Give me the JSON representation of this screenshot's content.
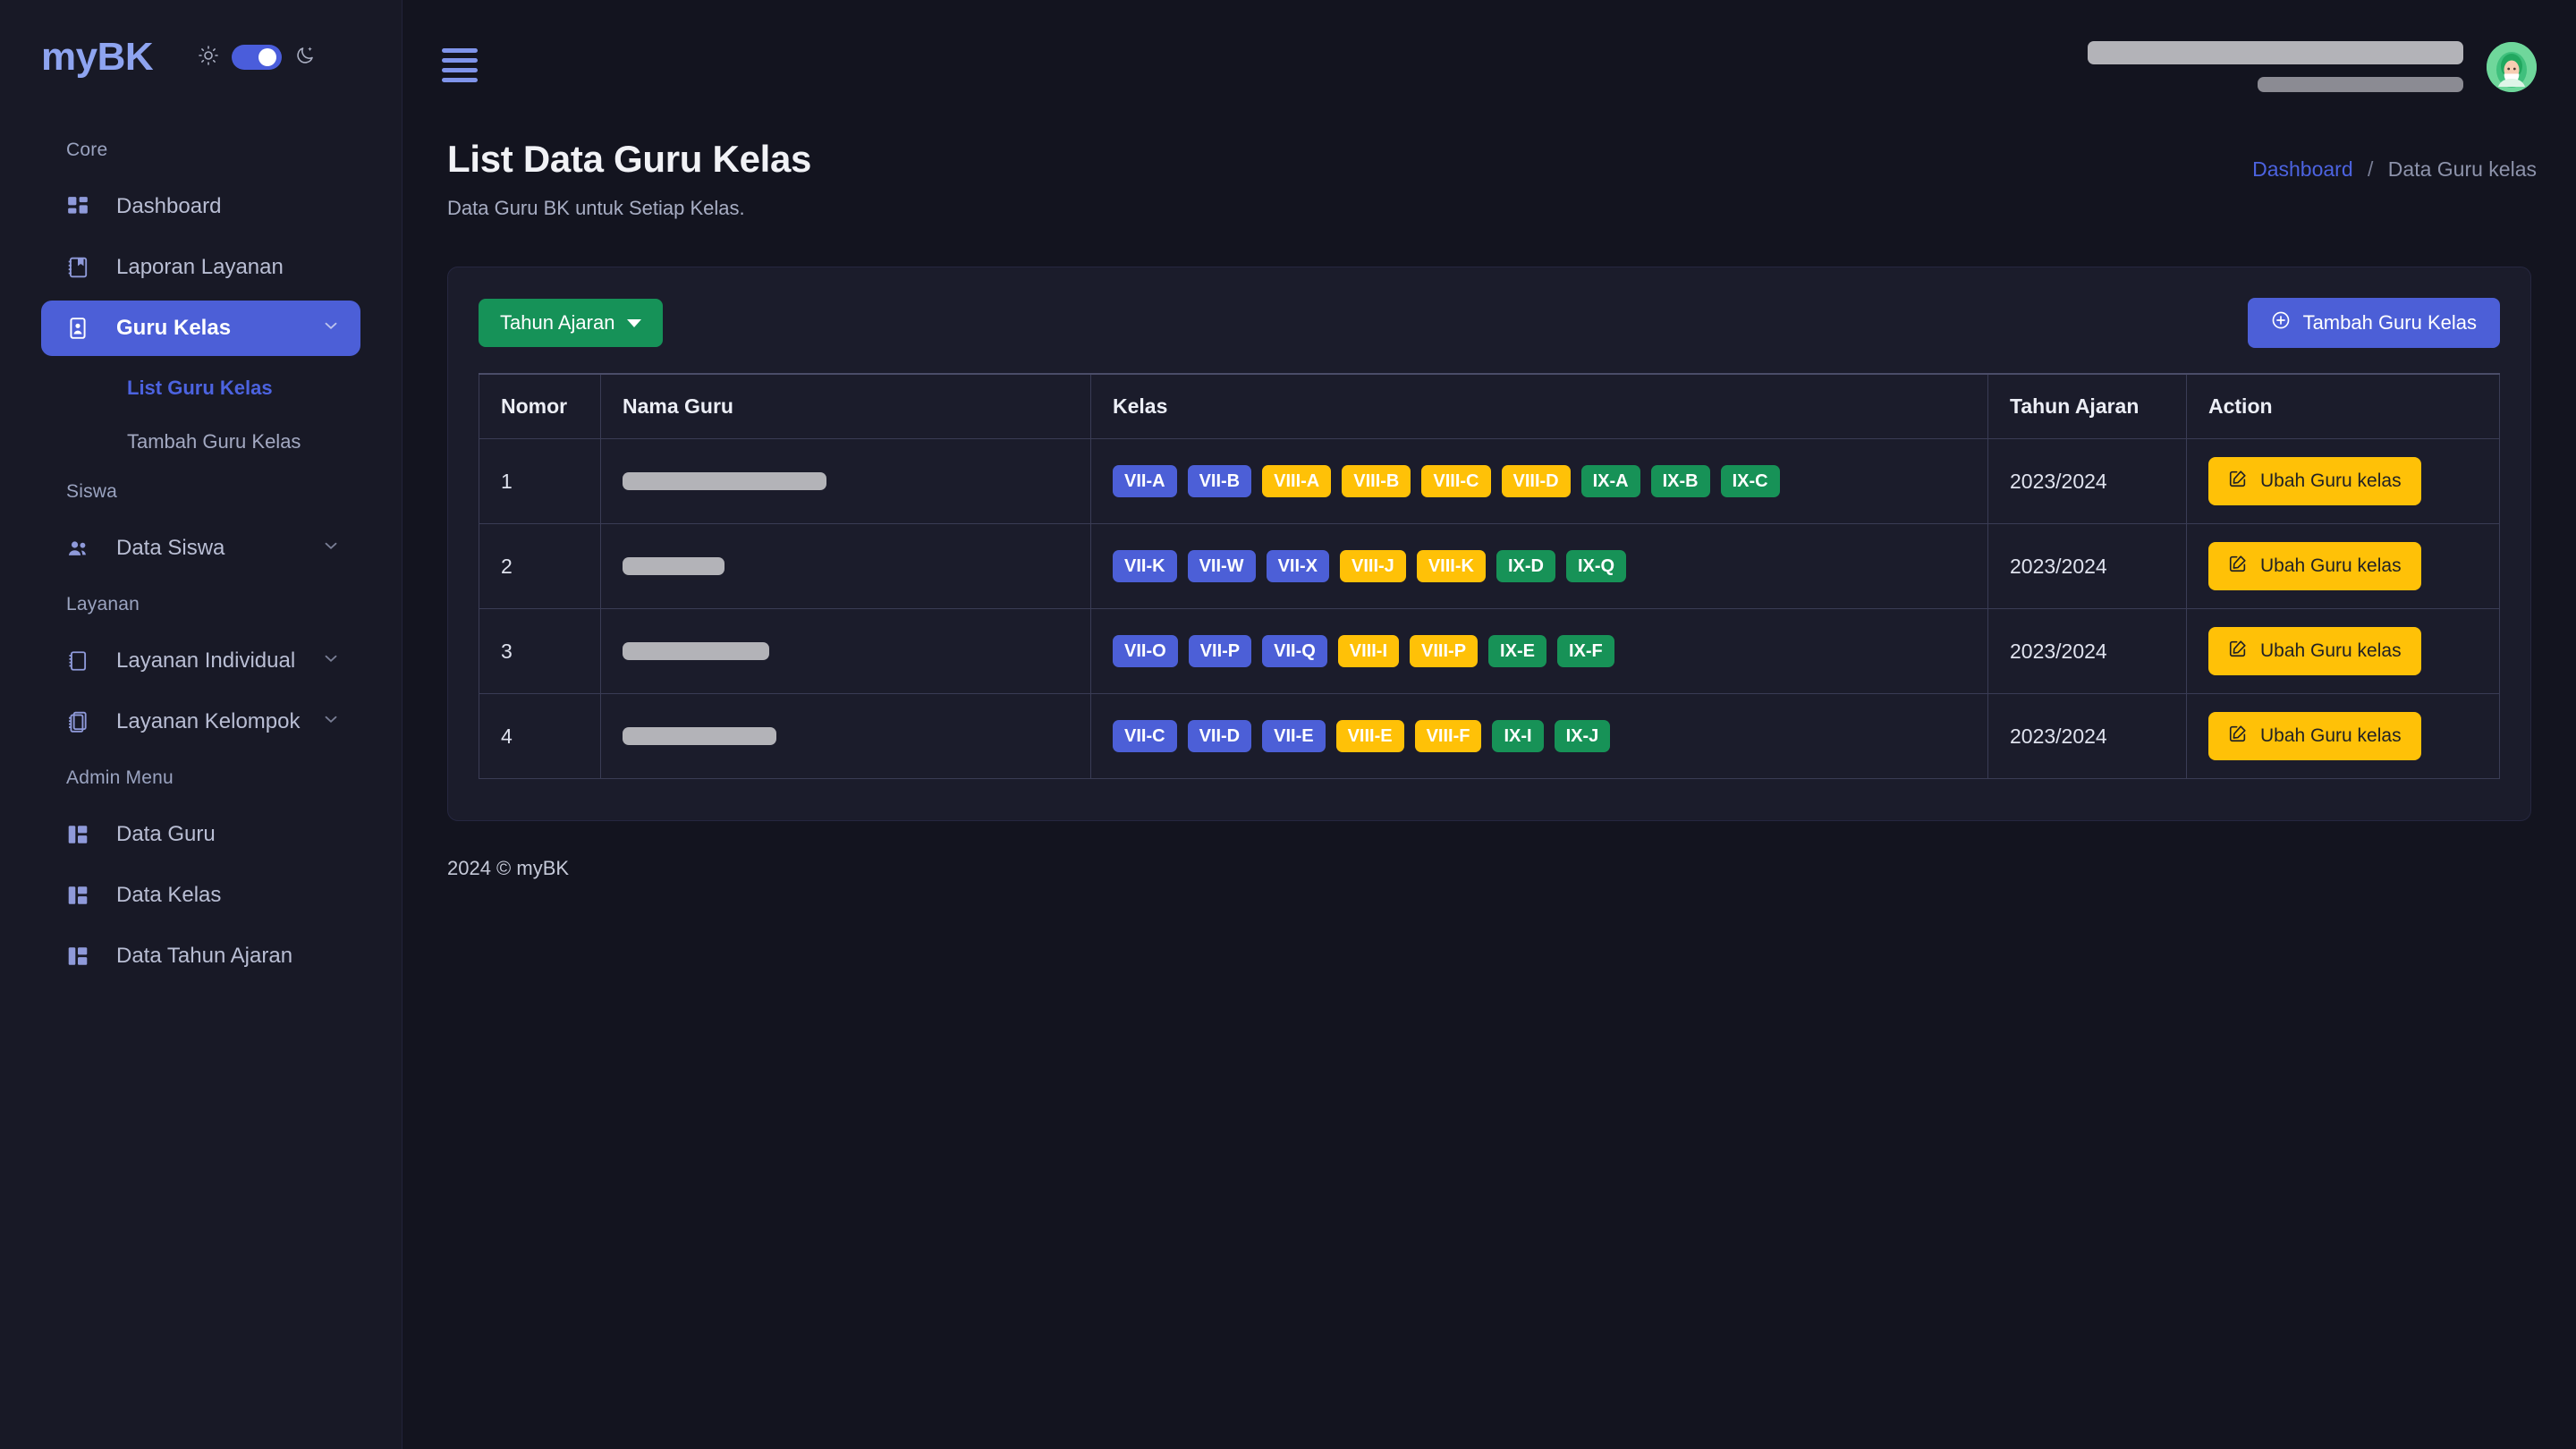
{
  "brand": {
    "name": "myBK",
    "sun_icon": "sun-icon",
    "moon_icon": "moon-icon",
    "toggle_state": "on"
  },
  "sidebar": {
    "sections": [
      {
        "label": "Core",
        "items": [
          {
            "label": "Dashboard",
            "icon": "grid-icon",
            "active": false,
            "expandable": false
          },
          {
            "label": "Laporan Layanan",
            "icon": "report-book-icon",
            "active": false,
            "expandable": false
          },
          {
            "label": "Guru Kelas",
            "icon": "id-card-icon",
            "active": true,
            "expandable": true
          }
        ],
        "subitems": [
          {
            "label": "List Guru Kelas",
            "active": true
          },
          {
            "label": "Tambah Guru Kelas",
            "active": false
          }
        ]
      },
      {
        "label": "Siswa",
        "items": [
          {
            "label": "Data Siswa",
            "icon": "people-icon",
            "active": false,
            "expandable": true
          }
        ],
        "subitems": []
      },
      {
        "label": "Layanan",
        "items": [
          {
            "label": "Layanan Individual",
            "icon": "notebook-icon",
            "active": false,
            "expandable": true
          },
          {
            "label": "Layanan Kelompok",
            "icon": "notebooks-icon",
            "active": false,
            "expandable": true
          }
        ],
        "subitems": []
      },
      {
        "label": "Admin Menu",
        "items": [
          {
            "label": "Data Guru",
            "icon": "columns-icon",
            "active": false,
            "expandable": false
          },
          {
            "label": "Data Kelas",
            "icon": "columns-icon",
            "active": false,
            "expandable": false
          },
          {
            "label": "Data Tahun Ajaran",
            "icon": "columns-icon",
            "active": false,
            "expandable": false
          }
        ],
        "subitems": []
      }
    ]
  },
  "topbar": {
    "menu_icon": "hamburger-icon",
    "user_name_redacted": true,
    "user_role_redacted": true,
    "avatar_icon": "user-avatar-hijab-icon"
  },
  "page": {
    "title": "List Data Guru Kelas",
    "subtitle": "Data Guru BK untuk Setiap Kelas.",
    "breadcrumb": {
      "root": "Dashboard",
      "separator": "/",
      "current": "Data Guru kelas"
    }
  },
  "toolbar": {
    "year_filter_label": "Tahun Ajaran",
    "year_filter_icon": "caret-down-icon",
    "add_label": "Tambah Guru Kelas",
    "add_icon": "plus-circle-icon"
  },
  "table": {
    "columns": [
      "Nomor",
      "Nama Guru",
      "Kelas",
      "Tahun Ajaran",
      "Action"
    ],
    "rows": [
      {
        "nomor": "1",
        "nama_guru_redacted": true,
        "nama_width": 228,
        "kelas": [
          {
            "label": "VII-A",
            "color": "blue"
          },
          {
            "label": "VII-B",
            "color": "blue"
          },
          {
            "label": "VIII-A",
            "color": "yellow"
          },
          {
            "label": "VIII-B",
            "color": "yellow"
          },
          {
            "label": "VIII-C",
            "color": "yellow"
          },
          {
            "label": "VIII-D",
            "color": "yellow"
          },
          {
            "label": "IX-A",
            "color": "green"
          },
          {
            "label": "IX-B",
            "color": "green"
          },
          {
            "label": "IX-C",
            "color": "green"
          }
        ],
        "tahun_ajaran": "2023/2024",
        "action_label": "Ubah Guru kelas",
        "action_icon": "edit-square-icon"
      },
      {
        "nomor": "2",
        "nama_guru_redacted": true,
        "nama_width": 114,
        "kelas": [
          {
            "label": "VII-K",
            "color": "blue"
          },
          {
            "label": "VII-W",
            "color": "blue"
          },
          {
            "label": "VII-X",
            "color": "blue"
          },
          {
            "label": "VIII-J",
            "color": "yellow"
          },
          {
            "label": "VIII-K",
            "color": "yellow"
          },
          {
            "label": "IX-D",
            "color": "green"
          },
          {
            "label": "IX-Q",
            "color": "green"
          }
        ],
        "tahun_ajaran": "2023/2024",
        "action_label": "Ubah Guru kelas",
        "action_icon": "edit-square-icon"
      },
      {
        "nomor": "3",
        "nama_guru_redacted": true,
        "nama_width": 164,
        "kelas": [
          {
            "label": "VII-O",
            "color": "blue"
          },
          {
            "label": "VII-P",
            "color": "blue"
          },
          {
            "label": "VII-Q",
            "color": "blue"
          },
          {
            "label": "VIII-I",
            "color": "yellow"
          },
          {
            "label": "VIII-P",
            "color": "yellow"
          },
          {
            "label": "IX-E",
            "color": "green"
          },
          {
            "label": "IX-F",
            "color": "green"
          }
        ],
        "tahun_ajaran": "2023/2024",
        "action_label": "Ubah Guru kelas",
        "action_icon": "edit-square-icon"
      },
      {
        "nomor": "4",
        "nama_guru_redacted": true,
        "nama_width": 172,
        "kelas": [
          {
            "label": "VII-C",
            "color": "blue"
          },
          {
            "label": "VII-D",
            "color": "blue"
          },
          {
            "label": "VII-E",
            "color": "blue"
          },
          {
            "label": "VIII-E",
            "color": "yellow"
          },
          {
            "label": "VIII-F",
            "color": "yellow"
          },
          {
            "label": "IX-I",
            "color": "green"
          },
          {
            "label": "IX-J",
            "color": "green"
          }
        ],
        "tahun_ajaran": "2023/2024",
        "action_label": "Ubah Guru kelas",
        "action_icon": "edit-square-icon"
      }
    ]
  },
  "footer": {
    "text": "2024 © myBK"
  },
  "colors": {
    "accent_blue": "#4c5fd7",
    "brand_blue": "#8ea4f0",
    "green": "#169258",
    "yellow": "#ffc107",
    "sidebar_bg": "#181926",
    "page_bg": "#13141f",
    "card_bg": "#1b1c2b"
  }
}
